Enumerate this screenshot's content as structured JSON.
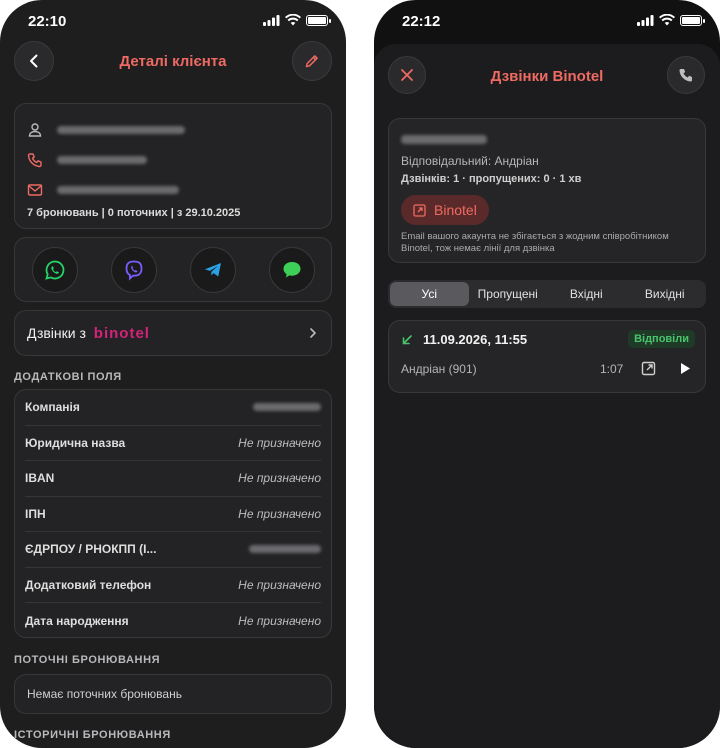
{
  "left": {
    "status_time": "22:10",
    "title": "Деталі клієнта",
    "stats": "7 бронювань | 0 поточних | з 29.10.2025",
    "binotel_link_prefix": "Дзвінки з",
    "binotel_brand": "binotel",
    "section_additional": "ДОДАТКОВІ ПОЛЯ",
    "fields": [
      {
        "label": "Компанія",
        "value": ""
      },
      {
        "label": "Юридична назва",
        "value": "Не призначено"
      },
      {
        "label": "IBAN",
        "value": "Не призначено"
      },
      {
        "label": "ІПН",
        "value": "Не призначено"
      },
      {
        "label": "ЄДРПОУ / РНОКПП (І...",
        "value": ""
      },
      {
        "label": "Додатковий телефон",
        "value": "Не призначено"
      },
      {
        "label": "Дата народження",
        "value": "Не призначено"
      }
    ],
    "section_current": "ПОТОЧНІ БРОНЮВАННЯ",
    "no_current": "Немає поточних бронювань",
    "section_history": "ІСТОРИЧНІ БРОНЮВАННЯ",
    "colors": {
      "accent": "#ee6a62",
      "whatsapp": "#25d366",
      "viber": "#7b5cff",
      "telegram": "#2aa3e6",
      "messages": "#3ecf59",
      "binotel": "#d4237a"
    }
  },
  "right": {
    "status_time": "22:12",
    "title": "Дзвінки Binotel",
    "responsible": "Відповідальний: Андріан",
    "summary": "Дзвінків: 1 · пропущених: 0 · 1 хв",
    "binotel_button": "Binotel",
    "warning": "Email вашого акаунта не збігається з жодним співробітником Binotel, тож немає лінії для дзвінка",
    "tabs": [
      "Усі",
      "Пропущені",
      "Вхідні",
      "Вихідні"
    ],
    "active_tab": "Усі",
    "call": {
      "datetime": "11.09.2026, 11:55",
      "status": "Відповіли",
      "agent": "Андріан (901)",
      "duration": "1:07"
    }
  }
}
